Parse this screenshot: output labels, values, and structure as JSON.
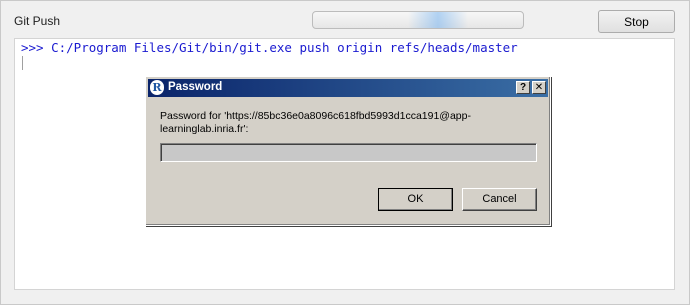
{
  "window": {
    "title": "Git Push",
    "stop_label": "Stop"
  },
  "console": {
    "command": ">>> C:/Program Files/Git/bin/git.exe push origin refs/heads/master"
  },
  "dialog": {
    "icon_letter": "R",
    "title": "Password",
    "help_glyph": "?",
    "close_glyph": "✕",
    "prompt": "Password for 'https://85bc36e0a8096c618fbd5993d1cca191@app-learninglab.inria.fr':",
    "password_value": "",
    "ok_label": "OK",
    "cancel_label": "Cancel"
  }
}
